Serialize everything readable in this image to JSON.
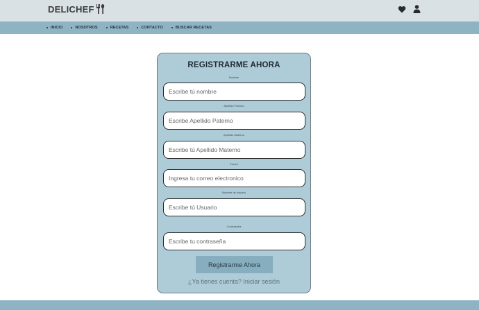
{
  "brand": {
    "name": "DELICHEF",
    "logo_icon": "fork-spoon-icon"
  },
  "header": {
    "icons": [
      "heart-icon",
      "user-icon"
    ]
  },
  "nav": {
    "items": [
      "INICIO",
      "NOSOTROS",
      "RECETAS",
      "CONTACTO",
      "BUSCAR RECETAS"
    ]
  },
  "form": {
    "title": "REGISTRARME AHORA",
    "fields": [
      {
        "label": "Nombre",
        "placeholder": "Escribe tú nombre",
        "value": ""
      },
      {
        "label": "Apellido Paterno",
        "placeholder": "Escribe Apellido Paterno",
        "value": ""
      },
      {
        "label": "Apellido Materno",
        "placeholder": "Escribe tú Apellido Materno",
        "value": ""
      },
      {
        "label": "Correo",
        "placeholder": "Ingresa tu correo electronico",
        "value": ""
      },
      {
        "label": "Nombre de usuario",
        "placeholder": "Escribe tú Usuario",
        "value": ""
      },
      {
        "label": "Contraseña",
        "placeholder": "Escribe tu contraseña",
        "value": ""
      }
    ],
    "submit_label": "Registrarme Ahora",
    "login_link": "¿Ya tienes cuenta? Iniciar sesión"
  },
  "colors": {
    "topbar": "#d9e1e5",
    "navbar": "#8eb3c3",
    "card": "#aecbd8",
    "button": "#86aebf"
  }
}
